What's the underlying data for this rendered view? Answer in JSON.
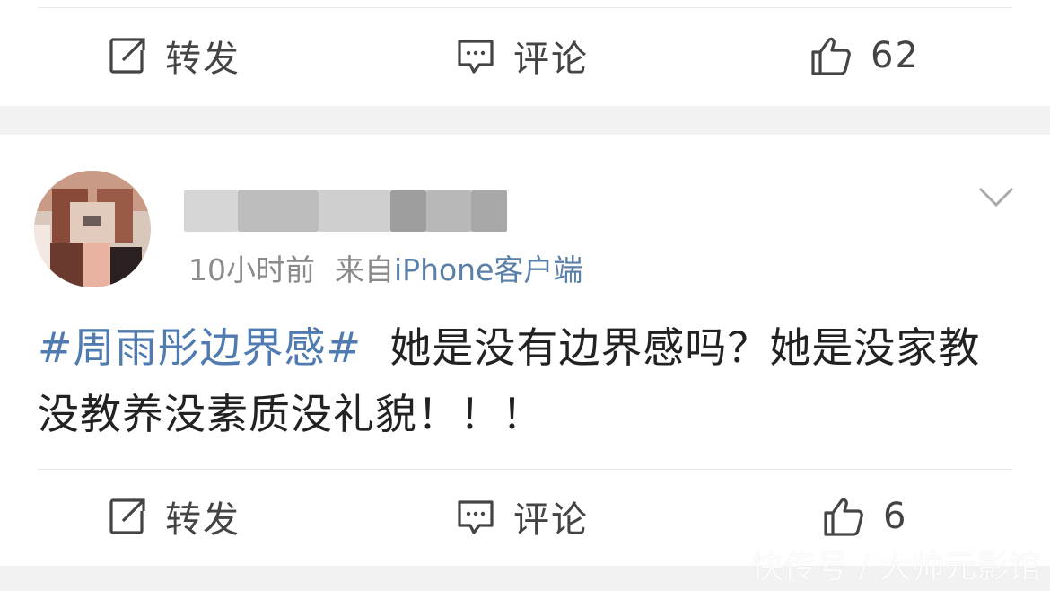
{
  "top_actions": {
    "repost_label": "转发",
    "comment_label": "评论",
    "like_count": "62"
  },
  "post": {
    "time": "10小时前",
    "source_prefix": "来自",
    "source": "iPhone客户端",
    "hashtag": "#周雨彤边界感#",
    "text": "她是没有边界感吗？她是没家教没教养没素质没礼貌！！！"
  },
  "bottom_actions": {
    "repost_label": "转发",
    "comment_label": "评论",
    "like_count": "6"
  },
  "watermark": "快传号 / 大帅元影馆",
  "colors": {
    "hashtag": "#4f7bb0",
    "source": "#5a7fa8",
    "gap": "#f2f2f2"
  }
}
